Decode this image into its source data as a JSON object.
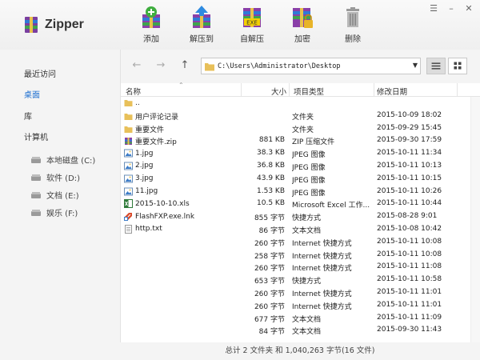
{
  "app": {
    "title": "Zipper"
  },
  "toolbar": [
    {
      "label": "添加",
      "icon": "add-archive-icon"
    },
    {
      "label": "解压到",
      "icon": "extract-to-icon"
    },
    {
      "label": "自解压",
      "icon": "self-extract-exe-icon",
      "badge": "EXE"
    },
    {
      "label": "加密",
      "icon": "encrypt-archive-icon"
    },
    {
      "label": "删除",
      "icon": "trash-icon"
    }
  ],
  "window_buttons": {
    "menu": "☰",
    "minimize": "–",
    "close": "✕"
  },
  "sidebar": {
    "items": [
      {
        "label": "最近访问",
        "active": false
      },
      {
        "label": "桌面",
        "active": true
      },
      {
        "label": "库",
        "active": false
      },
      {
        "label": "计算机",
        "active": false
      }
    ],
    "drives": [
      {
        "label": "本地磁盘 (C:)"
      },
      {
        "label": "软件 (D:)"
      },
      {
        "label": "文档 (E:)"
      },
      {
        "label": "娱乐 (F:)"
      }
    ]
  },
  "nav": {
    "back": "←",
    "forward": "→",
    "up": "↑",
    "path": "C:\\Users\\Administrator\\Desktop",
    "dropdown": "▼"
  },
  "columns": {
    "name": "名称",
    "size": "大小",
    "type": "项目类型",
    "date": "修改日期"
  },
  "files": [
    {
      "name": "..",
      "size": "",
      "type": "",
      "date": "",
      "icon": "folder"
    },
    {
      "name": "用户评论记录",
      "size": "",
      "type": "文件夹",
      "date": "2015-10-09 18:02",
      "icon": "folder"
    },
    {
      "name": "重要文件",
      "size": "",
      "type": "文件夹",
      "date": "2015-09-29 15:45",
      "icon": "folder"
    },
    {
      "name": "重要文件.zip",
      "size": "881 KB",
      "type": "ZIP 压缩文件",
      "date": "2015-09-30 17:59",
      "icon": "zip"
    },
    {
      "name": "1.jpg",
      "size": "38.3 KB",
      "type": "JPEG 图像",
      "date": "2015-10-11 11:34",
      "icon": "image"
    },
    {
      "name": "2.jpg",
      "size": "36.8 KB",
      "type": "JPEG 图像",
      "date": "2015-10-11 10:13",
      "icon": "image"
    },
    {
      "name": "3.jpg",
      "size": "43.9 KB",
      "type": "JPEG 图像",
      "date": "2015-10-11 10:15",
      "icon": "image"
    },
    {
      "name": "11.jpg",
      "size": "1.53 KB",
      "type": "JPEG 图像",
      "date": "2015-10-11 10:26",
      "icon": "image"
    },
    {
      "name": "2015-10-10.xls",
      "size": "10.5 KB",
      "type": "Microsoft Excel 工作...",
      "date": "2015-10-11 10:44",
      "icon": "excel"
    },
    {
      "name": "FlashFXP.exe.lnk",
      "size": "855 字节",
      "type": "快捷方式",
      "date": "2015-08-28 9:01",
      "icon": "shortcut"
    },
    {
      "name": "http.txt",
      "size": "86 字节",
      "type": "文本文档",
      "date": "2015-10-08 10:42",
      "icon": "text"
    },
    {
      "name": "",
      "size": "260 字节",
      "type": "Internet 快捷方式",
      "date": "2015-10-11 10:08",
      "icon": ""
    },
    {
      "name": "",
      "size": "258 字节",
      "type": "Internet 快捷方式",
      "date": "2015-10-11 10:08",
      "icon": ""
    },
    {
      "name": "",
      "size": "260 字节",
      "type": "Internet 快捷方式",
      "date": "2015-10-11 11:08",
      "icon": ""
    },
    {
      "name": "",
      "size": "653 字节",
      "type": "快捷方式",
      "date": "2015-10-11 10:58",
      "icon": ""
    },
    {
      "name": "",
      "size": "260 字节",
      "type": "Internet 快捷方式",
      "date": "2015-10-11 11:01",
      "icon": ""
    },
    {
      "name": "",
      "size": "260 字节",
      "type": "Internet 快捷方式",
      "date": "2015-10-11 11:01",
      "icon": ""
    },
    {
      "name": "",
      "size": "677 字节",
      "type": "文本文档",
      "date": "2015-10-11 11:09",
      "icon": ""
    },
    {
      "name": "",
      "size": "84 字节",
      "type": "文本文档",
      "date": "2015-09-30 11:43",
      "icon": ""
    }
  ],
  "status": "总计 2 文件夹 和 1,040,263 字节(16 文件)",
  "colors": {
    "accent": "#1e6fd0",
    "folder": "#e8c05a"
  }
}
